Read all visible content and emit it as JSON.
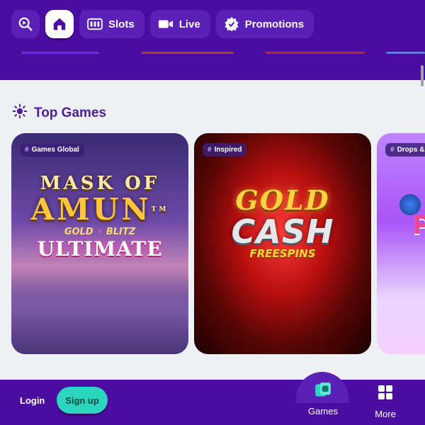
{
  "header": {
    "nav": {
      "search_icon": "search-icon",
      "home_icon": "home-icon",
      "slots_label": "Slots",
      "live_label": "Live",
      "promotions_label": "Promotions"
    }
  },
  "section": {
    "title": "Top Games"
  },
  "games": [
    {
      "tag": "Games Global",
      "logo_line1": "MASK OF",
      "logo_line2": "AMUN",
      "logo_tm": "TM",
      "logo_line3a": "GOLD",
      "logo_line3b": "BLITZ",
      "logo_line4": "ULTIMATE"
    },
    {
      "tag": "Inspired",
      "logo_line1": "GOLD",
      "logo_line2": "CASH",
      "logo_line3": "FREESPINS"
    },
    {
      "tag": "Drops &",
      "logo_letter": "P"
    }
  ],
  "bottom_bar": {
    "login_label": "Login",
    "signup_label": "Sign up",
    "games_label": "Games",
    "more_label": "More"
  },
  "colors": {
    "header_bg": "#4a0da0",
    "nav_button_bg": "#5b21b6",
    "accent_teal": "#2dd4bf",
    "section_title": "#4c1d95"
  }
}
